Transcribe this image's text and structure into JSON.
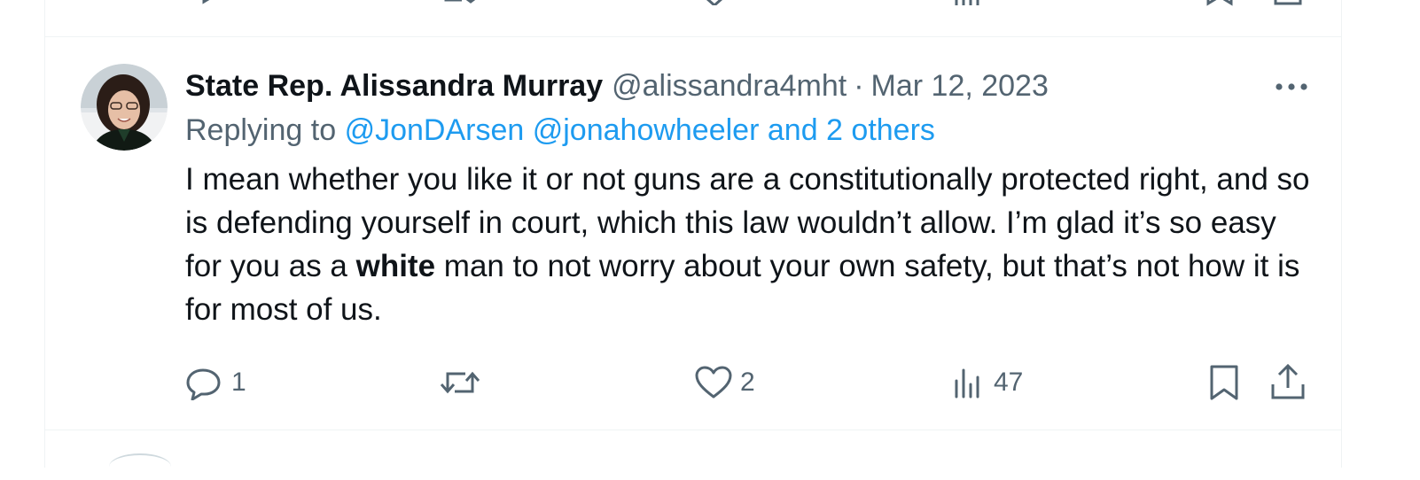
{
  "tweet": {
    "display_name": "State Rep. Alissandra Murray",
    "handle": "@alissandra4mht",
    "separator": "·",
    "date": "Mar 12, 2023",
    "replying_prefix": "Replying to",
    "reply_mention_1": "@JonDArsen",
    "reply_mention_2": "@jonahowheeler",
    "reply_others": "and 2 others",
    "body_part1": "I mean whether you like it or not guns are a constitutionally protected right, and so is defending yourself in court, which this law wouldn’t allow. I’m glad it’s so easy for you as a ",
    "body_bold": "white",
    "body_part2": " man to not worry about your own safety, but that’s not how it is for most of us."
  },
  "actions": {
    "reply_count": "1",
    "retweet_count": "",
    "like_count": "2",
    "views_count": "47"
  },
  "icons": {
    "more": "more-icon",
    "reply": "reply-icon",
    "retweet": "retweet-icon",
    "like": "heart-icon",
    "views": "views-icon",
    "bookmark": "bookmark-icon",
    "share": "share-icon"
  },
  "colors": {
    "link": "#1d9bf0",
    "secondary_text": "#536471",
    "primary_text": "#0f1419",
    "divider": "#eff3f4"
  }
}
